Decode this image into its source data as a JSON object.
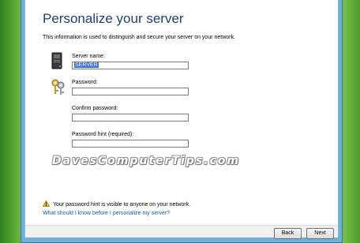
{
  "page": {
    "title": "Personalize your server",
    "intro": "This information is used to distinguish and secure your server on your network."
  },
  "form": {
    "server_name_label": "Server name:",
    "server_name_value": "SERVER",
    "password_label": "Password:",
    "confirm_password_label": "Confirm password:",
    "password_hint_label": "Password hint (required):"
  },
  "watermark": "DavesComputerTips.com",
  "warning": {
    "text": "Your password hint is visible to anyone on your network.",
    "icon": "warning-icon"
  },
  "help_link": "What should I know before I personalize my server?",
  "buttons": {
    "back": "Back",
    "next": "Next"
  },
  "colors": {
    "title": "#1e3f7a",
    "link": "#1a56b8",
    "selection": "#3b6fd8"
  }
}
